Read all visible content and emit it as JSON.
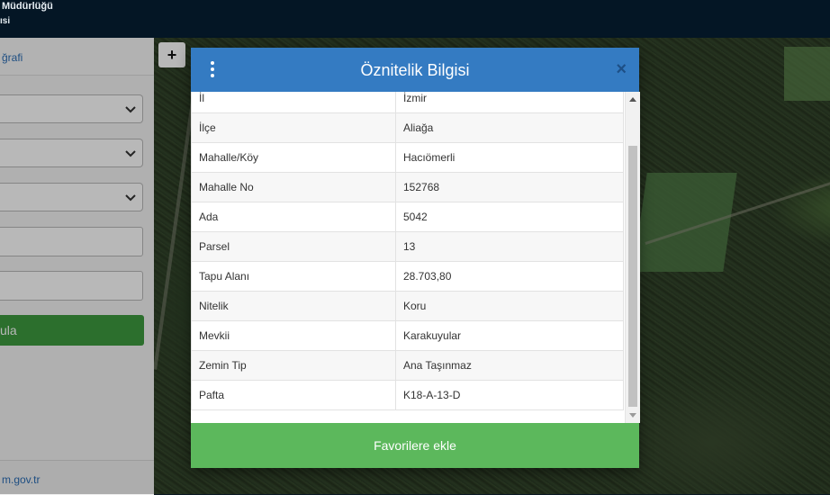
{
  "header": {
    "line1": "Müdürlüğü",
    "line2": "ısi"
  },
  "sidebar": {
    "tab_label": "ğrafi",
    "search_button_label": "ula",
    "footer_text": "m.gov.tr"
  },
  "map": {
    "zoom_in_label": "+"
  },
  "modal": {
    "title": "Öznitelik Bilgisi",
    "close_label": "×",
    "favorite_button_label": "Favorilere ekle",
    "rows": [
      {
        "key": "İl",
        "value": "İzmir"
      },
      {
        "key": "İlçe",
        "value": "Aliağa"
      },
      {
        "key": "Mahalle/Köy",
        "value": "Hacıömerli"
      },
      {
        "key": "Mahalle No",
        "value": "152768"
      },
      {
        "key": "Ada",
        "value": "5042"
      },
      {
        "key": "Parsel",
        "value": "13"
      },
      {
        "key": "Tapu Alanı",
        "value": "28.703,80"
      },
      {
        "key": "Nitelik",
        "value": "Koru"
      },
      {
        "key": "Mevkii",
        "value": "Karakuyular"
      },
      {
        "key": "Zemin Tip",
        "value": "Ana Taşınmaz"
      },
      {
        "key": "Pafta",
        "value": "K18-A-13-D"
      }
    ]
  },
  "colors": {
    "modal_header": "#347bc2",
    "favorite_button": "#5cb85c",
    "sidebar_button": "#3d9a3f",
    "top_bar": "#041625"
  }
}
